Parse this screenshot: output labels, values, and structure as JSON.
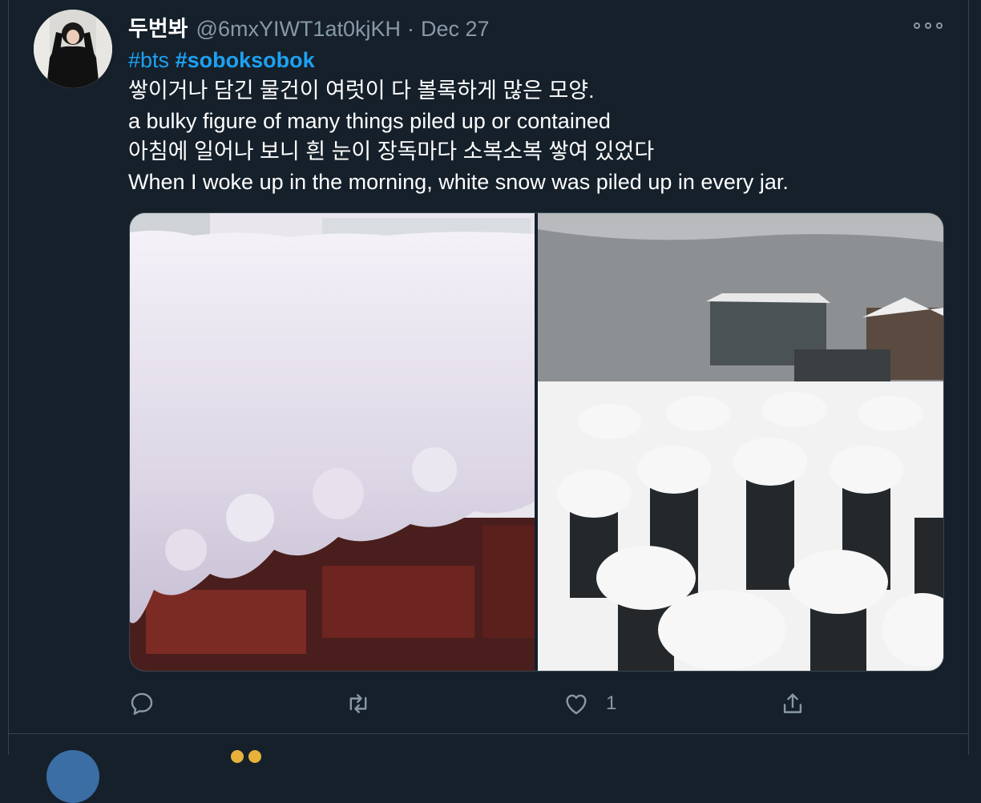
{
  "tweet": {
    "display_name": "두번봐",
    "handle": "@6mxYIWT1at0kjKH",
    "separator": "·",
    "date": "Dec 27",
    "hashtags": [
      "#bts",
      "#soboksobok"
    ],
    "lines": [
      "쌓이거나 담긴 물건이 여럿이 다 볼록하게 많은 모양.",
      "a bulky figure of many things piled up or contained",
      "아침에 일어나 보니 흰 눈이 장독마다 소복소복 쌓여 있었다",
      "When I woke up in the morning, white snow was piled up in every jar."
    ],
    "media": [
      {
        "icon": "snow-on-brick-wall-photo"
      },
      {
        "icon": "snow-covered-jars-photo"
      }
    ],
    "actions": {
      "reply_icon": "reply-icon",
      "retweet_icon": "retweet-icon",
      "like_icon": "heart-icon",
      "like_count": "1",
      "share_icon": "share-icon"
    }
  },
  "colors": {
    "background": "#15202b",
    "text": "#ffffff",
    "muted": "#8899a6",
    "link": "#1da1f2",
    "border": "#38444d"
  }
}
